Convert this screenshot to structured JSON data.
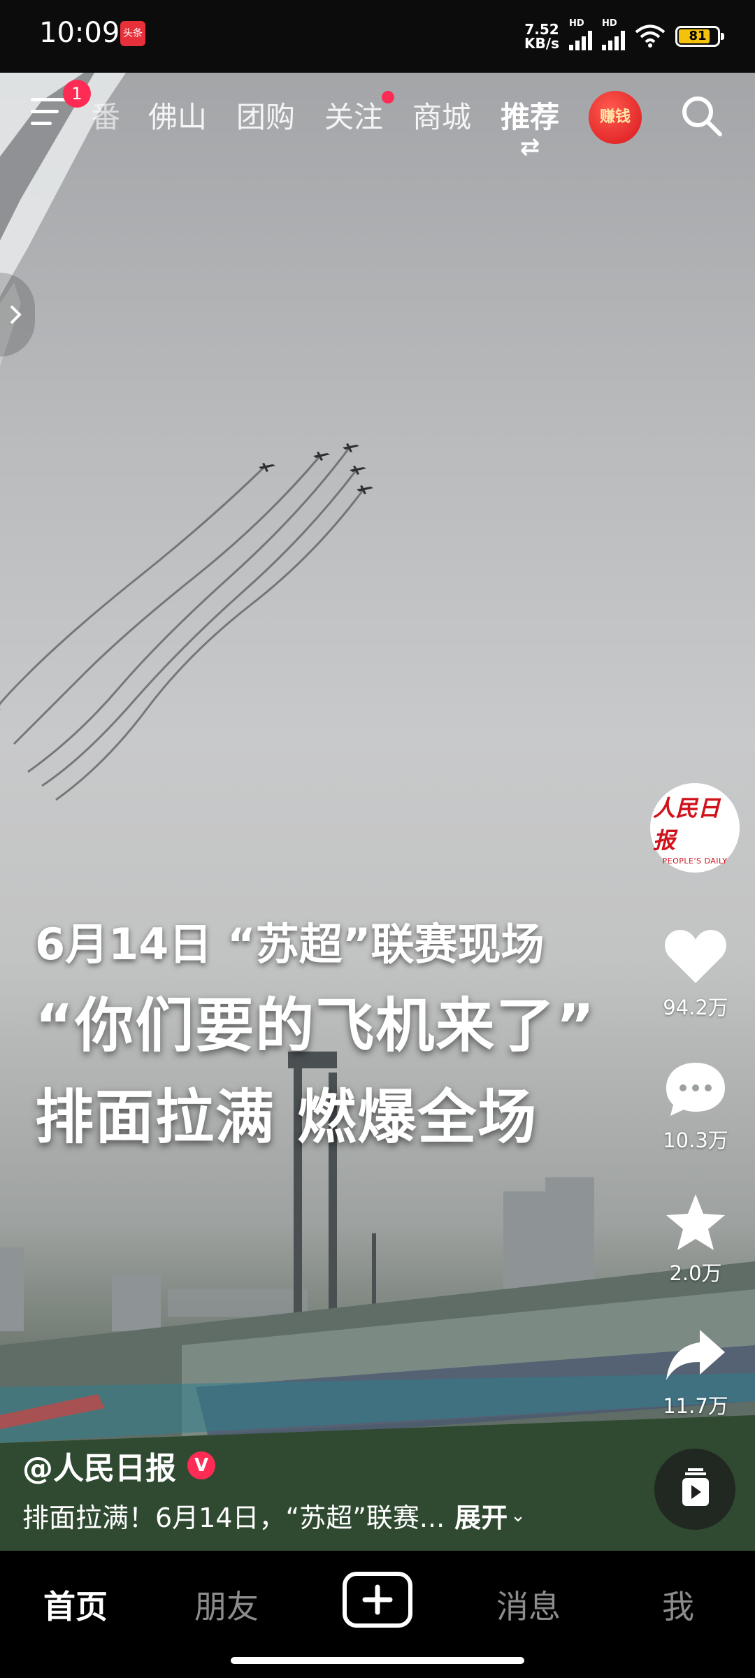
{
  "status_bar": {
    "time": "10:09",
    "app_icon_label": "头条",
    "net_speed_value": "7.52",
    "net_speed_unit": "KB/s",
    "signal_label_1": "HD",
    "signal_label_2": "HD",
    "battery": "81"
  },
  "top_nav": {
    "menu_badge": "1",
    "tabs": [
      {
        "label": "番"
      },
      {
        "label": "佛山"
      },
      {
        "label": "团购"
      },
      {
        "label": "关注"
      },
      {
        "label": "商城"
      },
      {
        "label": "推荐"
      }
    ],
    "earn_label": "赚钱"
  },
  "video": {
    "caption_line1": "6月14日 “苏超”联赛现场",
    "caption_line2": "“你们要的飞机来了”",
    "caption_line3": "排面拉满 燃爆全场"
  },
  "right_rail": {
    "avatar_logo": "人民日报",
    "avatar_logo_sub": "PEOPLE'S DAILY",
    "like_count": "94.2万",
    "comment_count": "10.3万",
    "favorite_count": "2.0万",
    "share_count": "11.7万"
  },
  "post": {
    "author": "@人民日报",
    "verified_mark": "V",
    "description": "排面拉满！6月14日，“苏超”联赛...",
    "expand_label": "展开"
  },
  "bottom_nav": {
    "tabs": [
      {
        "label": "首页"
      },
      {
        "label": "朋友"
      },
      {
        "label": "消息"
      },
      {
        "label": "我"
      }
    ]
  },
  "colors": {
    "accent": "#fe2c55",
    "battery_fill": "#f4c20d"
  }
}
